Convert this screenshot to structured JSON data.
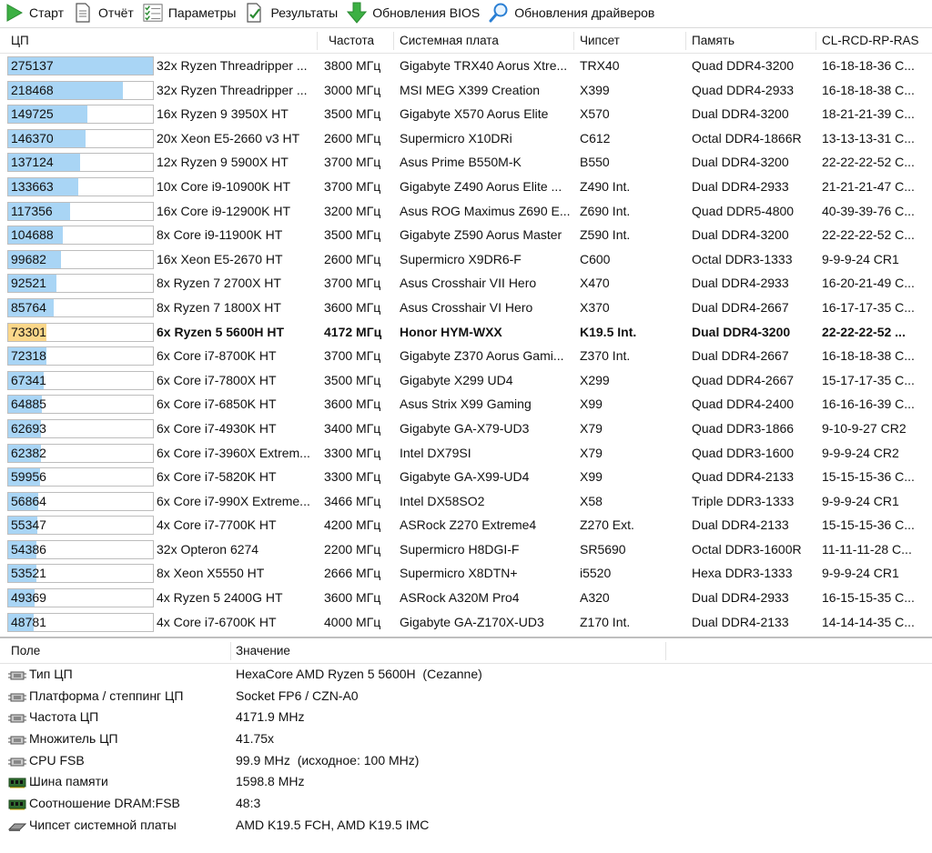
{
  "toolbar": {
    "start": "Старт",
    "report": "Отчёт",
    "params": "Параметры",
    "results": "Результаты",
    "bios": "Обновления BIOS",
    "drivers": "Обновления драйверов"
  },
  "list": {
    "columns": [
      "ЦП",
      "Частота",
      "Системная плата",
      "Чипсет",
      "Память",
      "CL-RCD-RP-RAS"
    ],
    "max_score": 275137,
    "rows": [
      {
        "score": "275137",
        "cpu": "32x Ryzen Threadripper ...",
        "freq": "3800 МГц",
        "board": "Gigabyte TRX40 Aorus Xtre...",
        "chipset": "TRX40",
        "mem": "Quad DDR4-3200",
        "timings": "16-18-18-36 C..."
      },
      {
        "score": "218468",
        "cpu": "32x Ryzen Threadripper ...",
        "freq": "3000 МГц",
        "board": "MSI MEG X399 Creation",
        "chipset": "X399",
        "mem": "Quad DDR4-2933",
        "timings": "16-18-18-38 C..."
      },
      {
        "score": "149725",
        "cpu": "16x Ryzen 9 3950X HT",
        "freq": "3500 МГц",
        "board": "Gigabyte X570 Aorus Elite",
        "chipset": "X570",
        "mem": "Dual DDR4-3200",
        "timings": "18-21-21-39 C..."
      },
      {
        "score": "146370",
        "cpu": "20x Xeon E5-2660 v3 HT",
        "freq": "2600 МГц",
        "board": "Supermicro X10DRi",
        "chipset": "C612",
        "mem": "Octal DDR4-1866R",
        "timings": "13-13-13-31 C..."
      },
      {
        "score": "137124",
        "cpu": "12x Ryzen 9 5900X HT",
        "freq": "3700 МГц",
        "board": "Asus Prime B550M-K",
        "chipset": "B550",
        "mem": "Dual DDR4-3200",
        "timings": "22-22-22-52 C..."
      },
      {
        "score": "133663",
        "cpu": "10x Core i9-10900K HT",
        "freq": "3700 МГц",
        "board": "Gigabyte Z490 Aorus Elite ...",
        "chipset": "Z490 Int.",
        "mem": "Dual DDR4-2933",
        "timings": "21-21-21-47 C..."
      },
      {
        "score": "117356",
        "cpu": "16x Core i9-12900K HT",
        "freq": "3200 МГц",
        "board": "Asus ROG Maximus Z690 E...",
        "chipset": "Z690 Int.",
        "mem": "Quad DDR5-4800",
        "timings": "40-39-39-76 C..."
      },
      {
        "score": "104688",
        "cpu": "8x Core i9-11900K HT",
        "freq": "3500 МГц",
        "board": "Gigabyte Z590 Aorus Master",
        "chipset": "Z590 Int.",
        "mem": "Dual DDR4-3200",
        "timings": "22-22-22-52 C..."
      },
      {
        "score": "99682",
        "cpu": "16x Xeon E5-2670 HT",
        "freq": "2600 МГц",
        "board": "Supermicro X9DR6-F",
        "chipset": "C600",
        "mem": "Octal DDR3-1333",
        "timings": "9-9-9-24 CR1"
      },
      {
        "score": "92521",
        "cpu": "8x Ryzen 7 2700X HT",
        "freq": "3700 МГц",
        "board": "Asus Crosshair VII Hero",
        "chipset": "X470",
        "mem": "Dual DDR4-2933",
        "timings": "16-20-21-49 C..."
      },
      {
        "score": "85764",
        "cpu": "8x Ryzen 7 1800X HT",
        "freq": "3600 МГц",
        "board": "Asus Crosshair VI Hero",
        "chipset": "X370",
        "mem": "Dual DDR4-2667",
        "timings": "16-17-17-35 C..."
      },
      {
        "score": "73301",
        "cpu": "6x Ryzen 5 5600H HT",
        "freq": "4172 МГц",
        "board": "Honor HYM-WXX",
        "chipset": "K19.5 Int.",
        "mem": "Dual DDR4-3200",
        "timings": "22-22-22-52 ...",
        "highlight": true
      },
      {
        "score": "72318",
        "cpu": "6x Core i7-8700K HT",
        "freq": "3700 МГц",
        "board": "Gigabyte Z370 Aorus Gami...",
        "chipset": "Z370 Int.",
        "mem": "Dual DDR4-2667",
        "timings": "16-18-18-38 C..."
      },
      {
        "score": "67341",
        "cpu": "6x Core i7-7800X HT",
        "freq": "3500 МГц",
        "board": "Gigabyte X299 UD4",
        "chipset": "X299",
        "mem": "Quad DDR4-2667",
        "timings": "15-17-17-35 C..."
      },
      {
        "score": "64885",
        "cpu": "6x Core i7-6850K HT",
        "freq": "3600 МГц",
        "board": "Asus Strix X99 Gaming",
        "chipset": "X99",
        "mem": "Quad DDR4-2400",
        "timings": "16-16-16-39 C..."
      },
      {
        "score": "62693",
        "cpu": "6x Core i7-4930K HT",
        "freq": "3400 МГц",
        "board": "Gigabyte GA-X79-UD3",
        "chipset": "X79",
        "mem": "Quad DDR3-1866",
        "timings": "9-10-9-27 CR2"
      },
      {
        "score": "62382",
        "cpu": "6x Core i7-3960X Extrem...",
        "freq": "3300 МГц",
        "board": "Intel DX79SI",
        "chipset": "X79",
        "mem": "Quad DDR3-1600",
        "timings": "9-9-9-24 CR2"
      },
      {
        "score": "59956",
        "cpu": "6x Core i7-5820K HT",
        "freq": "3300 МГц",
        "board": "Gigabyte GA-X99-UD4",
        "chipset": "X99",
        "mem": "Quad DDR4-2133",
        "timings": "15-15-15-36 C..."
      },
      {
        "score": "56864",
        "cpu": "6x Core i7-990X Extreme...",
        "freq": "3466 МГц",
        "board": "Intel DX58SO2",
        "chipset": "X58",
        "mem": "Triple DDR3-1333",
        "timings": "9-9-9-24 CR1"
      },
      {
        "score": "55347",
        "cpu": "4x Core i7-7700K HT",
        "freq": "4200 МГц",
        "board": "ASRock Z270 Extreme4",
        "chipset": "Z270 Ext.",
        "mem": "Dual DDR4-2133",
        "timings": "15-15-15-36 C..."
      },
      {
        "score": "54386",
        "cpu": "32x Opteron 6274",
        "freq": "2200 МГц",
        "board": "Supermicro H8DGI-F",
        "chipset": "SR5690",
        "mem": "Octal DDR3-1600R",
        "timings": "11-11-11-28 C..."
      },
      {
        "score": "53521",
        "cpu": "8x Xeon X5550 HT",
        "freq": "2666 МГц",
        "board": "Supermicro X8DTN+",
        "chipset": "i5520",
        "mem": "Hexa DDR3-1333",
        "timings": "9-9-9-24 CR1"
      },
      {
        "score": "49369",
        "cpu": "4x Ryzen 5 2400G HT",
        "freq": "3600 МГц",
        "board": "ASRock A320M Pro4",
        "chipset": "A320",
        "mem": "Dual DDR4-2933",
        "timings": "16-15-15-35 C..."
      },
      {
        "score": "48781",
        "cpu": "4x Core i7-6700K HT",
        "freq": "4000 МГц",
        "board": "Gigabyte GA-Z170X-UD3",
        "chipset": "Z170 Int.",
        "mem": "Dual DDR4-2133",
        "timings": "14-14-14-35 C..."
      }
    ]
  },
  "details": {
    "col_field": "Поле",
    "col_value": "Значение",
    "rows": [
      {
        "field": "Тип ЦП",
        "value": "HexaCore AMD Ryzen 5 5600H  (Cezanne)",
        "icon": "cpu"
      },
      {
        "field": "Платформа / степпинг ЦП",
        "value": "Socket FP6 / CZN-A0",
        "icon": "cpu"
      },
      {
        "field": "Частота ЦП",
        "value": "4171.9 MHz",
        "icon": "cpu"
      },
      {
        "field": "Множитель ЦП",
        "value": "41.75x",
        "icon": "cpu"
      },
      {
        "field": "CPU FSB",
        "value": "99.9 MHz  (исходное: 100 MHz)",
        "icon": "cpu"
      },
      {
        "field": "Шина памяти",
        "value": "1598.8 MHz",
        "icon": "memory"
      },
      {
        "field": "Соотношение DRAM:FSB",
        "value": "48:3",
        "icon": "memory"
      },
      {
        "field": "Чипсет системной платы",
        "value": "AMD K19.5 FCH, AMD K19.5 IMC",
        "icon": "chipset"
      }
    ]
  }
}
